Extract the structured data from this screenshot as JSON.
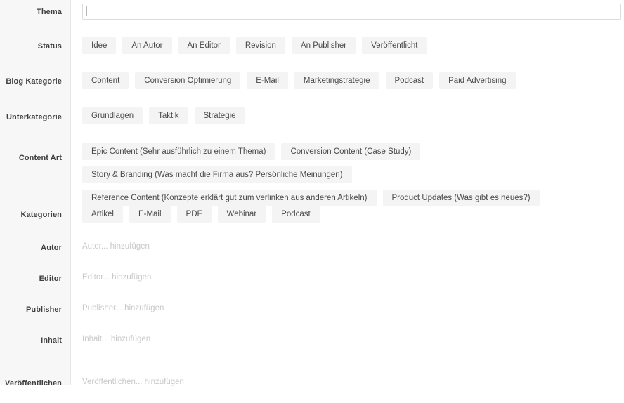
{
  "form": {
    "rows": [
      {
        "label": "Thema",
        "type": "text-input",
        "value": "",
        "placeholder": ""
      },
      {
        "label": "Status",
        "type": "tags",
        "tags": [
          "Idee",
          "An Autor",
          "An Editor",
          "Revision",
          "An Publisher",
          "Veröffentlicht"
        ]
      },
      {
        "label": "Blog Kategorie",
        "type": "tags",
        "tags": [
          "Content",
          "Conversion Optimierung",
          "E-Mail",
          "Marketingstrategie",
          "Podcast",
          "Paid Advertising"
        ]
      },
      {
        "label": "Unterkategorie",
        "type": "tags",
        "tags": [
          "Grundlagen",
          "Taktik",
          "Strategie"
        ]
      },
      {
        "label": "Content Art",
        "type": "tags",
        "tags": [
          "Epic Content (Sehr ausführlich zu einem Thema)",
          "Conversion Content (Case Study)",
          "Story & Branding (Was macht die Firma aus? Persönliche Meinungen)",
          "Reference Content (Konzepte erklärt gut zum verlinken aus anderen Artikeln)",
          "Product Updates (Was gibt es neues?)"
        ]
      },
      {
        "label": "Kategorien",
        "type": "tags",
        "tags": [
          "Artikel",
          "E-Mail",
          "PDF",
          "Webinar",
          "Podcast"
        ]
      },
      {
        "label": "Autor",
        "type": "add",
        "placeholder": "Autor... hinzufügen"
      },
      {
        "label": "Editor",
        "type": "add",
        "placeholder": "Editor... hinzufügen"
      },
      {
        "label": "Publisher",
        "type": "add",
        "placeholder": "Publisher... hinzufügen"
      },
      {
        "label": "Inhalt",
        "type": "add",
        "placeholder": "Inhalt... hinzufügen"
      },
      {
        "label": "Veröffentlichen",
        "type": "add",
        "placeholder": "Veröffentlichen... hinzufügen"
      }
    ]
  },
  "colors": {
    "page_background": "#ffffff",
    "gutter_background": "#f7f7f7",
    "gutter_divider": "#e6e6e6",
    "tag_background": "#f4f4f4",
    "tag_text": "#4a4a4a",
    "label_text": "#3f3f3f",
    "placeholder_text": "#c9c9c9",
    "input_border": "#dcdcdc",
    "caret": "#b9b9b9"
  }
}
